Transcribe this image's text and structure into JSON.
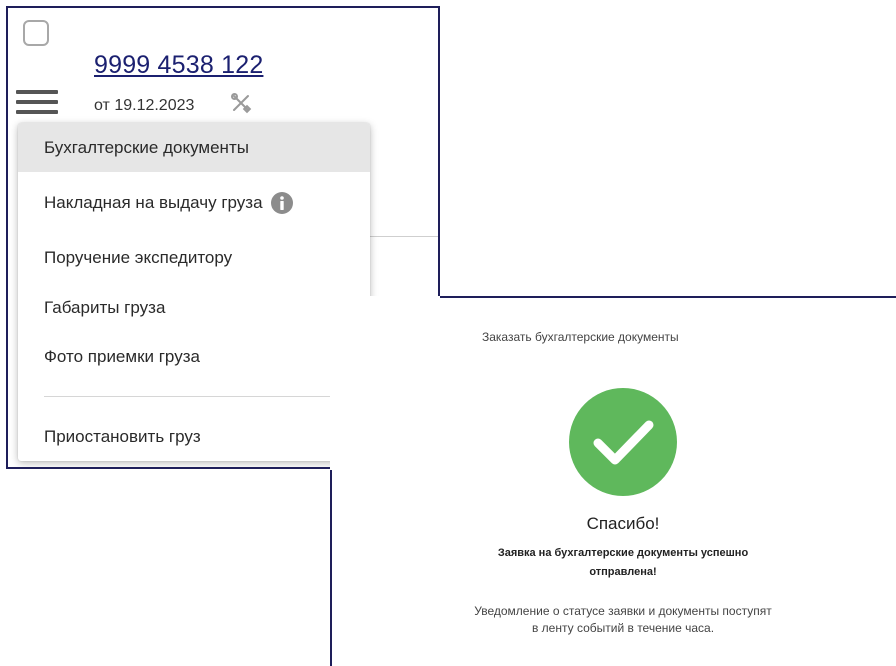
{
  "shipment": {
    "number": "9999 4538 122",
    "date": "от 19.12.2023"
  },
  "menu": {
    "items": [
      {
        "label": "Бухгалтерские документы"
      },
      {
        "label": "Накладная на выдачу груза"
      },
      {
        "label": "Поручение экспедитору"
      },
      {
        "label": "Габариты груза"
      },
      {
        "label": "Фото приемки груза"
      },
      {
        "label": "Приостановить груз"
      }
    ]
  },
  "confirmation": {
    "title": "Заказать бухгалтерские документы",
    "thanks": "Спасибо!",
    "success_message": "Заявка на бухгалтерские документы успешно отправлена!",
    "notice": "Уведомление о статусе заявки и документы поступят в ленту событий в течение часа."
  },
  "icons": {
    "menu": "hamburger-menu-icon",
    "tools": "tools-icon",
    "info": "info-icon",
    "success": "checkmark-circle-icon"
  },
  "colors": {
    "link": "#1b2070",
    "frame": "#1e1e5a",
    "success_green": "#5fb85c",
    "active_item_bg": "#e6e6e6"
  }
}
